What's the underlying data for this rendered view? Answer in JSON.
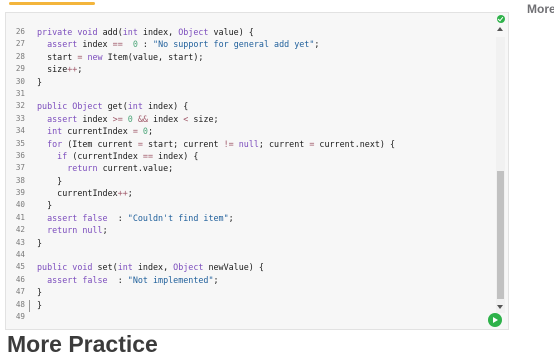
{
  "side_heading": "More",
  "section_title": "More Practice",
  "code_lines": [
    {
      "n": "26",
      "tokens": [
        [
          "kw",
          "private void "
        ],
        [
          "",
          "add("
        ],
        [
          "kw",
          "int "
        ],
        [
          "",
          "index, "
        ],
        [
          "kw",
          "Object "
        ],
        [
          "",
          "value) {"
        ]
      ]
    },
    {
      "n": "27",
      "tokens": [
        [
          "",
          "  "
        ],
        [
          "kw",
          "assert "
        ],
        [
          "",
          "index "
        ],
        [
          "op",
          "=="
        ],
        [
          "",
          "  "
        ],
        [
          "num",
          "0"
        ],
        [
          "",
          " : "
        ],
        [
          "str",
          "\"No support for general add yet\""
        ],
        [
          "",
          ";"
        ]
      ]
    },
    {
      "n": "28",
      "tokens": [
        [
          "",
          "  start "
        ],
        [
          "op",
          "="
        ],
        [
          "",
          " "
        ],
        [
          "kw",
          "new "
        ],
        [
          "",
          "Item(value, start);"
        ]
      ]
    },
    {
      "n": "29",
      "tokens": [
        [
          "",
          "  size"
        ],
        [
          "op",
          "++"
        ],
        [
          "",
          ";"
        ]
      ]
    },
    {
      "n": "30",
      "tokens": [
        [
          "",
          "}"
        ]
      ]
    },
    {
      "n": "31",
      "tokens": []
    },
    {
      "n": "32",
      "tokens": [
        [
          "kw",
          "public "
        ],
        [
          "kw",
          "Object "
        ],
        [
          "",
          "get("
        ],
        [
          "kw",
          "int "
        ],
        [
          "",
          "index) {"
        ]
      ]
    },
    {
      "n": "33",
      "tokens": [
        [
          "",
          "  "
        ],
        [
          "kw",
          "assert "
        ],
        [
          "",
          "index "
        ],
        [
          "op",
          ">="
        ],
        [
          "",
          " "
        ],
        [
          "num",
          "0"
        ],
        [
          "",
          " "
        ],
        [
          "op",
          "&&"
        ],
        [
          "",
          " index "
        ],
        [
          "op",
          "<"
        ],
        [
          "",
          " size;"
        ]
      ]
    },
    {
      "n": "34",
      "tokens": [
        [
          "",
          "  "
        ],
        [
          "kw",
          "int "
        ],
        [
          "",
          "currentIndex "
        ],
        [
          "op",
          "="
        ],
        [
          "",
          " "
        ],
        [
          "num",
          "0"
        ],
        [
          "",
          ";"
        ]
      ]
    },
    {
      "n": "35",
      "tokens": [
        [
          "",
          "  "
        ],
        [
          "kw",
          "for "
        ],
        [
          "",
          "(Item current "
        ],
        [
          "op",
          "="
        ],
        [
          "",
          " start; current "
        ],
        [
          "op",
          "!="
        ],
        [
          "",
          " "
        ],
        [
          "kw",
          "null"
        ],
        [
          "",
          "; current "
        ],
        [
          "op",
          "="
        ],
        [
          "",
          " current.next) {"
        ]
      ]
    },
    {
      "n": "36",
      "tokens": [
        [
          "",
          "    "
        ],
        [
          "kw",
          "if "
        ],
        [
          "",
          "(currentIndex "
        ],
        [
          "op",
          "=="
        ],
        [
          "",
          " index) {"
        ]
      ]
    },
    {
      "n": "37",
      "tokens": [
        [
          "",
          "      "
        ],
        [
          "kw",
          "return "
        ],
        [
          "",
          "current.value;"
        ]
      ]
    },
    {
      "n": "38",
      "tokens": [
        [
          "",
          "    }"
        ]
      ]
    },
    {
      "n": "39",
      "tokens": [
        [
          "",
          "    currentIndex"
        ],
        [
          "op",
          "++"
        ],
        [
          "",
          ";"
        ]
      ]
    },
    {
      "n": "40",
      "tokens": [
        [
          "",
          "  }"
        ]
      ]
    },
    {
      "n": "41",
      "tokens": [
        [
          "",
          "  "
        ],
        [
          "kw",
          "assert "
        ],
        [
          "kw",
          "false "
        ],
        [
          "",
          " : "
        ],
        [
          "str",
          "\"Couldn't find item\""
        ],
        [
          "",
          ";"
        ]
      ]
    },
    {
      "n": "42",
      "tokens": [
        [
          "",
          "  "
        ],
        [
          "kw",
          "return "
        ],
        [
          "kw",
          "null"
        ],
        [
          "",
          ";"
        ]
      ]
    },
    {
      "n": "43",
      "tokens": [
        [
          "",
          "}"
        ]
      ]
    },
    {
      "n": "44",
      "tokens": []
    },
    {
      "n": "45",
      "tokens": [
        [
          "kw",
          "public void "
        ],
        [
          "",
          "set("
        ],
        [
          "kw",
          "int "
        ],
        [
          "",
          "index, "
        ],
        [
          "kw",
          "Object "
        ],
        [
          "",
          "newValue) {"
        ]
      ]
    },
    {
      "n": "46",
      "tokens": [
        [
          "",
          "  "
        ],
        [
          "kw",
          "assert "
        ],
        [
          "kw",
          "false "
        ],
        [
          "",
          " : "
        ],
        [
          "str",
          "\"Not implemented\""
        ],
        [
          "",
          ";"
        ]
      ]
    },
    {
      "n": "47",
      "tokens": [
        [
          "",
          "}"
        ]
      ]
    },
    {
      "n": "48",
      "tokens": [
        [
          "",
          "}"
        ]
      ]
    },
    {
      "n": "49",
      "tokens": []
    }
  ],
  "colors": {
    "keyword": "#7c4dbd",
    "string": "#1f5f9b",
    "number": "#4da67a",
    "operator": "#a05a6a",
    "accent": "#f3b53c",
    "run": "#2eb24a"
  },
  "icons": {
    "status": "check-circle-icon",
    "run": "play-icon"
  }
}
